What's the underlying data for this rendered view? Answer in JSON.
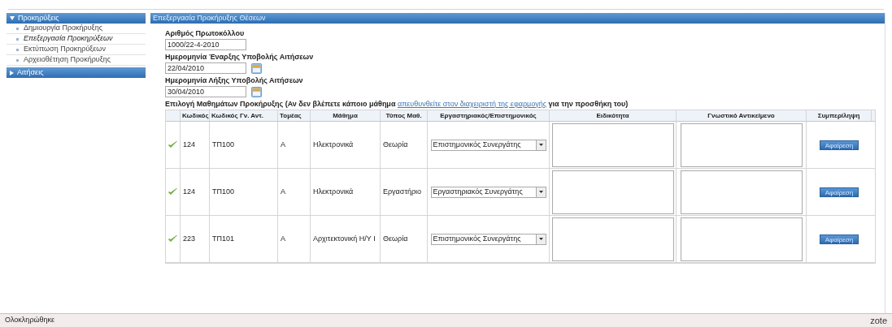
{
  "sidebar": {
    "groups": [
      {
        "title": "Προκηρύξεις",
        "expanded": true,
        "items": [
          {
            "label": "Δημιουργία Προκήρυξης",
            "selected": false
          },
          {
            "label": "Επεξεργασία Προκηρύξεων",
            "selected": true
          },
          {
            "label": "Εκτύπωση Προκηρύξεων",
            "selected": false
          },
          {
            "label": "Αρχειοθέτηση Προκήρυξης",
            "selected": false
          }
        ]
      },
      {
        "title": "Αιτήσεις",
        "expanded": false
      }
    ]
  },
  "panel": {
    "title": "Επεξεργασία Προκήρυξης Θέσεων",
    "fields": [
      {
        "label": "Αριθμός Πρωτοκόλλου",
        "value": "1000/22-4-2010",
        "kind": "text"
      },
      {
        "label": "Ημερομηνία Έναρξης Υποβολής Αιτήσεων",
        "value": "22/04/2010",
        "kind": "date"
      },
      {
        "label": "Ημερομηνία Λήξης Υποβολής Αιτήσεων",
        "value": "30/04/2010",
        "kind": "date"
      }
    ],
    "courses_note": {
      "before": "Επιλογή Μαθημάτων Προκήρυξης (Αν δεν βλέπετε κάποιο μάθημα",
      "link": "απευθυνθείτε στον διαχειριστή της εφαρμογής",
      "after": "για την προσθήκη του)"
    },
    "table": {
      "columns": [
        "Κωδικός",
        "Κωδικός Γν. Αντ.",
        "Τομέας",
        "Μάθημα",
        "Τύπος Μαθ.",
        "Εργαστηριακός/Επιστημονικός",
        "Ειδικότητα",
        "Γνωστικό Αντικείμενο",
        "Συμπερίληψη"
      ],
      "rows": [
        {
          "code": "124",
          "alt_code": "ΤΠ100",
          "sector": "Α",
          "course": "Ηλεκτρονικά",
          "type": "Θεωρία",
          "role": "Επιστημονικός Συνεργάτης",
          "action": "Αφαίρεση"
        },
        {
          "code": "124",
          "alt_code": "ΤΠ100",
          "sector": "Α",
          "course": "Ηλεκτρονικά",
          "type": "Εργαστήριο",
          "role": "Εργαστηριακός Συνεργάτης",
          "action": "Αφαίρεση"
        },
        {
          "code": "223",
          "alt_code": "ΤΠ101",
          "sector": "Α",
          "course": "Αρχιτεκτονική Η/Υ Ι",
          "type": "Θεωρία",
          "role": "Επιστημονικός Συνεργάτης",
          "action": "Αφαίρεση"
        }
      ]
    }
  },
  "status_bar": {
    "text": "Ολοκληρώθηκε",
    "addon": "zote"
  }
}
